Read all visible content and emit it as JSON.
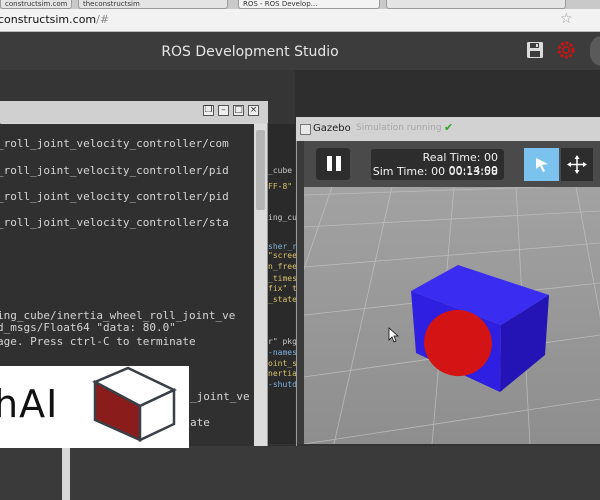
{
  "browser": {
    "tabs": [
      {
        "label": "constructsim.com"
      },
      {
        "label": "theconstructsim"
      },
      {
        "label": "ROS - ROS Develop..."
      },
      {
        "label": ""
      }
    ],
    "url_host": "constructsim.com",
    "url_path": "/#"
  },
  "app": {
    "title": "ROS Development Studio"
  },
  "terminal": {
    "lines": [
      "_roll_joint_velocity_controller/com",
      "_roll_joint_velocity_controller/pid",
      "_roll_joint_velocity_controller/pid",
      "_roll_joint_velocity_controller/sta",
      "ing_cube/inertia_wheel_roll_joint_ve",
      "d_msgs/Float64 \"data: 80.0\"",
      "age. Press ctrl-C to terminate",
      "_joint_ve",
      "ate"
    ]
  },
  "editor_fragments": [
    "_cube",
    "FF-8\"",
    "ing_cu",
    "sher_r",
    "\"scree",
    "n_free",
    "_times",
    "fix\" t",
    "_state",
    "r\" pkg",
    "-names",
    "oint_s",
    "nertia",
    "-shutd"
  ],
  "gazebo": {
    "window_title": "Gazebo",
    "status": "Simulation running",
    "real_time": "Real Time: 00 00:14:00",
    "sim_time": "Sim Time: 00 00:13:58"
  },
  "logo": {
    "text": "hAI"
  },
  "colors": {
    "cube_blue": "#2f1fe0",
    "cube_red": "#d41414",
    "select_blue": "#7bc2ee",
    "status_green": "#2aa52a",
    "logo_red": "#8a1c1c"
  }
}
